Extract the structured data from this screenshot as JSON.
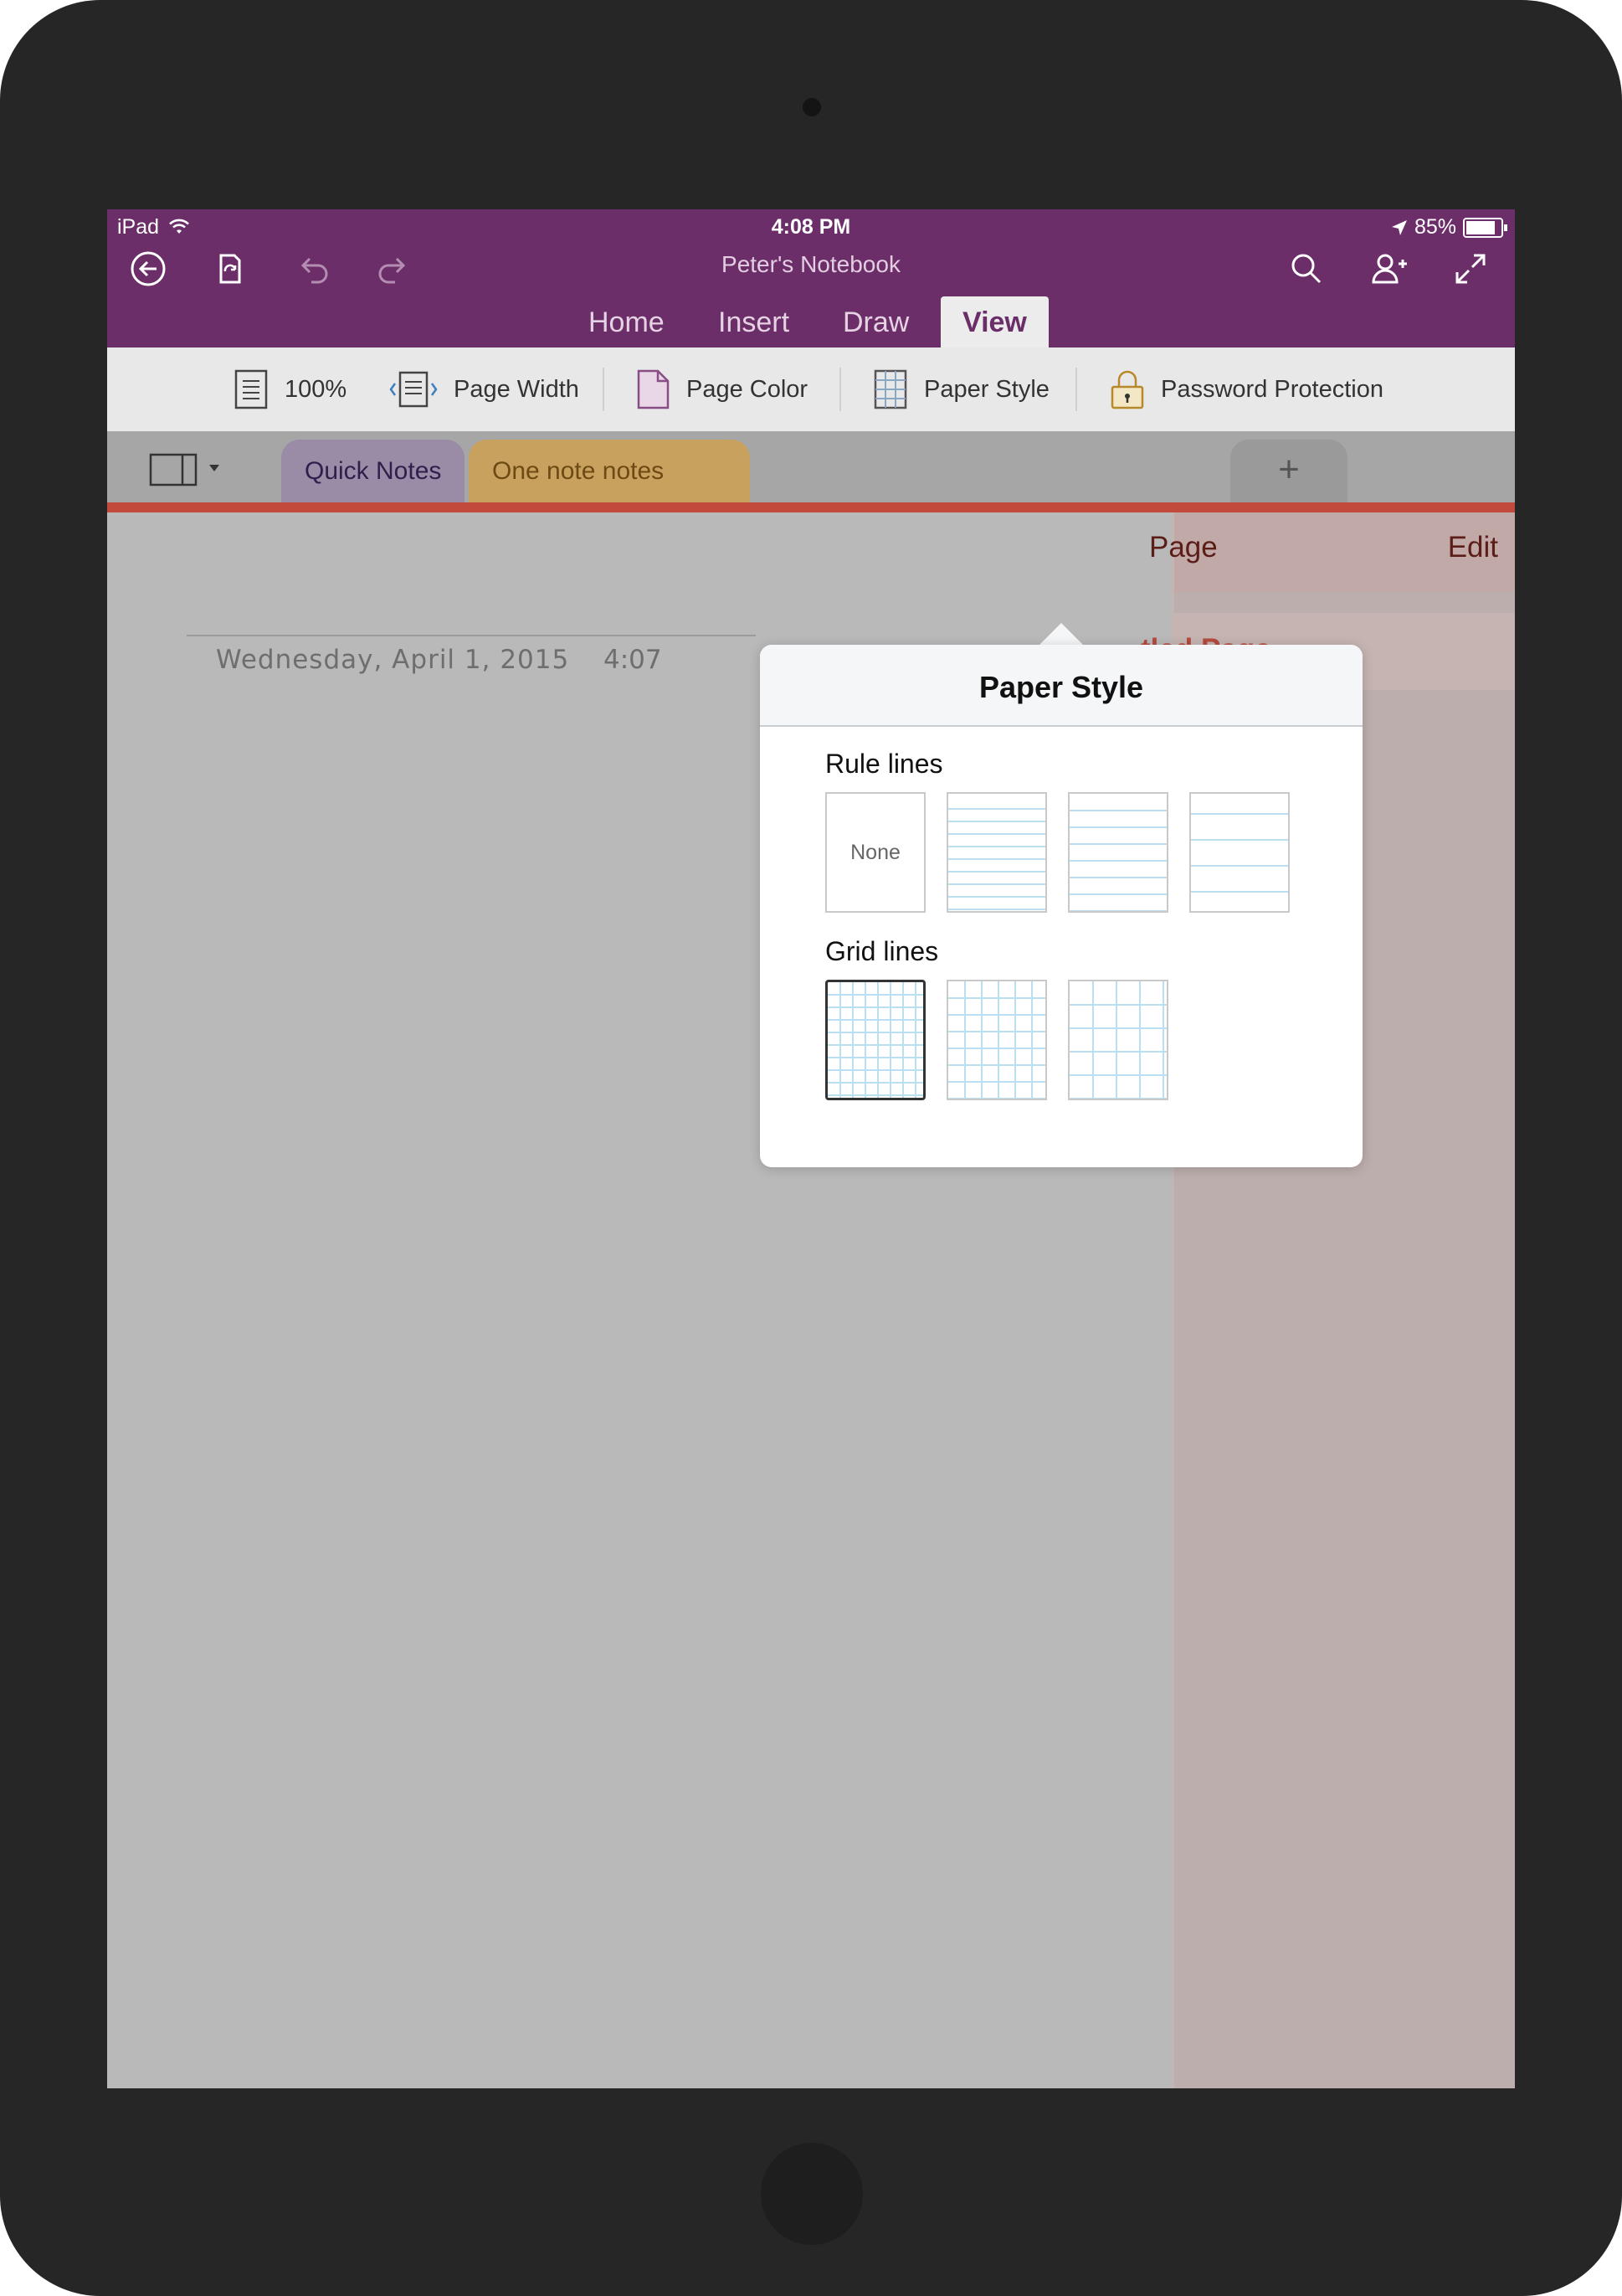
{
  "status_bar": {
    "device": "iPad",
    "time": "4:08 PM",
    "battery": "85%"
  },
  "notebook_title": "Peter's Notebook",
  "ribbon_tabs": [
    {
      "label": "Home",
      "active": false
    },
    {
      "label": "Insert",
      "active": false
    },
    {
      "label": "Draw",
      "active": false
    },
    {
      "label": "View",
      "active": true
    }
  ],
  "ribbon": {
    "zoom": "100%",
    "page_width": "Page Width",
    "page_color": "Page Color",
    "paper_style": "Paper Style",
    "password_protection": "Password Protection"
  },
  "sections": [
    {
      "label": "Quick Notes",
      "color": "#9a8ba6"
    },
    {
      "label": "One note notes",
      "color": "#c9a15f"
    }
  ],
  "page": {
    "date": "Wednesday, April 1, 2015",
    "time": "4:07"
  },
  "page_list": {
    "add_label": "Page",
    "edit_label": "Edit",
    "current_page": "tled Page"
  },
  "popover": {
    "title": "Paper Style",
    "rule_lines_label": "Rule lines",
    "grid_lines_label": "Grid lines",
    "rule_options": [
      "None",
      "narrow",
      "college",
      "wide"
    ],
    "grid_options": [
      "small",
      "medium",
      "large"
    ],
    "selected": "grid-small"
  },
  "colors": {
    "accent": "#6b2e68",
    "section_line": "#c14a3d",
    "paper_line": "#b9dff0"
  }
}
